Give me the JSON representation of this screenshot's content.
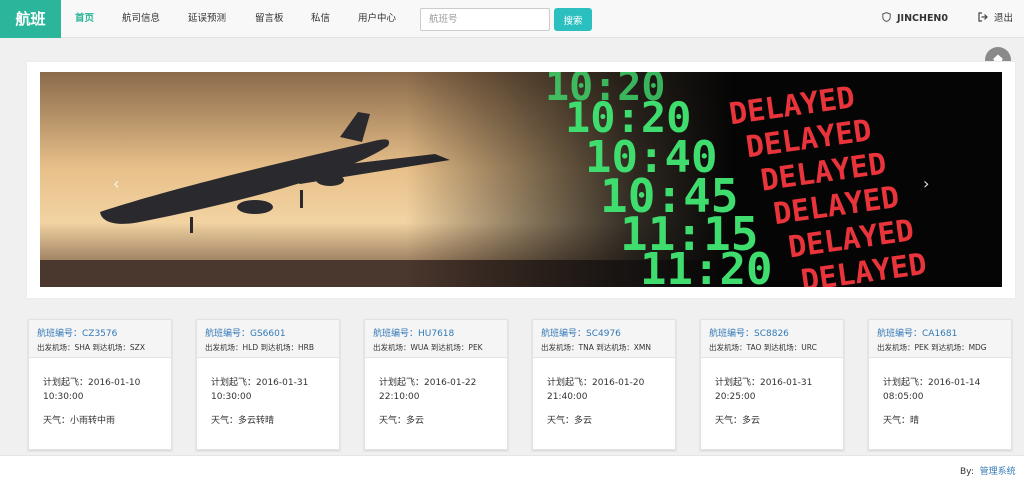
{
  "nav": {
    "brand": "航班",
    "items": [
      {
        "label": "首页",
        "active": true
      },
      {
        "label": "航司信息",
        "active": false
      },
      {
        "label": "延误预测",
        "active": false
      },
      {
        "label": "留言板",
        "active": false
      },
      {
        "label": "私信",
        "active": false
      },
      {
        "label": "用户中心",
        "active": false
      }
    ],
    "search_placeholder": "航班号",
    "search_button": "搜索",
    "username": "JINCHEN0",
    "logout": "退出"
  },
  "hero": {
    "board_times": [
      "10:20",
      "10:20",
      "10:40",
      "10:45",
      "11:15",
      "11:20"
    ],
    "board_status": [
      "DELAYED",
      "DELAYED",
      "DELAYED",
      "DELAYED",
      "DELAYED",
      "DELAYED"
    ],
    "prev": "‹",
    "next": "›"
  },
  "flights": [
    {
      "title": "航班编号：CZ3576",
      "airports": "出发机场：SHA 到达机场：SZX",
      "dep_label": "计划起飞：2016-01-10",
      "dep_time": "10:30:00",
      "weather": "天气：小雨转中雨"
    },
    {
      "title": "航班编号：GS6601",
      "airports": "出发机场：HLD 到达机场：HRB",
      "dep_label": "计划起飞：2016-01-31",
      "dep_time": "10:30:00",
      "weather": "天气：多云转晴"
    },
    {
      "title": "航班编号：HU7618",
      "airports": "出发机场：WUA 到达机场：PEK",
      "dep_label": "计划起飞：2016-01-22",
      "dep_time": "22:10:00",
      "weather": "天气：多云"
    },
    {
      "title": "航班编号：SC4976",
      "airports": "出发机场：TNA 到达机场：XMN",
      "dep_label": "计划起飞：2016-01-20",
      "dep_time": "21:40:00",
      "weather": "天气：多云"
    },
    {
      "title": "航班编号：SC8826",
      "airports": "出发机场：TAO 到达机场：URC",
      "dep_label": "计划起飞：2016-01-31",
      "dep_time": "20:25:00",
      "weather": "天气：多云"
    },
    {
      "title": "航班编号：CA1681",
      "airports": "出发机场：PEK 到达机场：MDG",
      "dep_label": "计划起飞：2016-01-14",
      "dep_time": "08:05:00",
      "weather": "天气：晴"
    }
  ],
  "footer": {
    "by": "By:",
    "link": "管理系统"
  },
  "colors": {
    "brand": "#2bb59a",
    "search_button": "#2bbfbf",
    "link": "#337ab7",
    "board_green": "#3fdc6e",
    "board_red": "#e8343a"
  },
  "icons": [
    "shield-icon",
    "logout-icon",
    "home-icon",
    "chevron-left-icon",
    "chevron-right-icon"
  ]
}
